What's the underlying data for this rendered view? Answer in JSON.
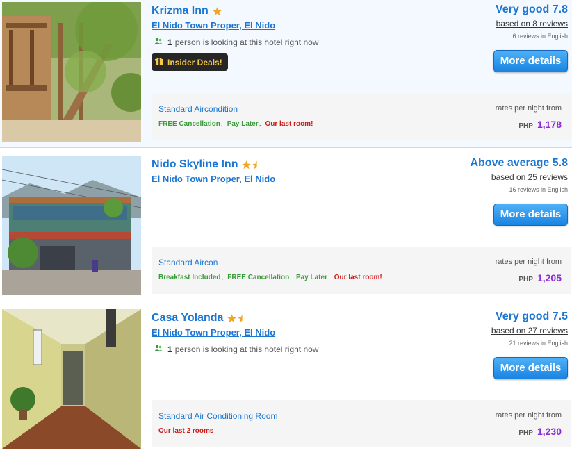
{
  "hotels": [
    {
      "name": "Krizma Inn",
      "star_rating": 1,
      "location": "El Nido Town Proper, El Nido",
      "looking_count": "1",
      "looking_text": "person is looking at this hotel right now",
      "deal_label": "Insider Deals!",
      "score_label": "Very good 7.8",
      "reviews": "based on 8 reviews",
      "reviews_english": "6 reviews in English",
      "more_label": "More details",
      "room_name": "Standard Aircondition",
      "features": [
        "FREE Cancellation",
        "Pay Later",
        "Our last room!"
      ],
      "rates_label": "rates per night from",
      "currency": "PHP",
      "price": "1,178"
    },
    {
      "name": "Nido Skyline Inn",
      "star_rating": 1.5,
      "location": "El Nido Town Proper, El Nido",
      "score_label": "Above average 5.8",
      "reviews": "based on 25 reviews",
      "reviews_english": "16 reviews in English",
      "more_label": "More details",
      "room_name": "Standard Aircon",
      "features": [
        "Breakfast Included",
        "FREE Cancellation",
        "Pay Later",
        "Our last room!"
      ],
      "rates_label": "rates per night from",
      "currency": "PHP",
      "price": "1,205"
    },
    {
      "name": "Casa Yolanda",
      "star_rating": 1.5,
      "location": "El Nido Town Proper, El Nido",
      "looking_count": "1",
      "looking_text": "person is looking at this hotel right now",
      "score_label": "Very good 7.5",
      "reviews": "based on 27 reviews",
      "reviews_english": "21 reviews in English",
      "more_label": "More details",
      "room_name": "Standard Air Conditioning Room",
      "features": [
        "Our last 2 rooms"
      ],
      "rates_label": "rates per night from",
      "currency": "PHP",
      "price": "1,230"
    }
  ],
  "colors": {
    "link_blue": "#1b75d2",
    "price_purple": "#8d2bd6",
    "feature_green": "#3a9b3a",
    "feature_red": "#d01818",
    "star_orange": "#f4a623"
  },
  "icons": {
    "star": "star-icon",
    "half_star": "half-star-icon",
    "people": "people-icon",
    "gift": "gift-icon"
  }
}
